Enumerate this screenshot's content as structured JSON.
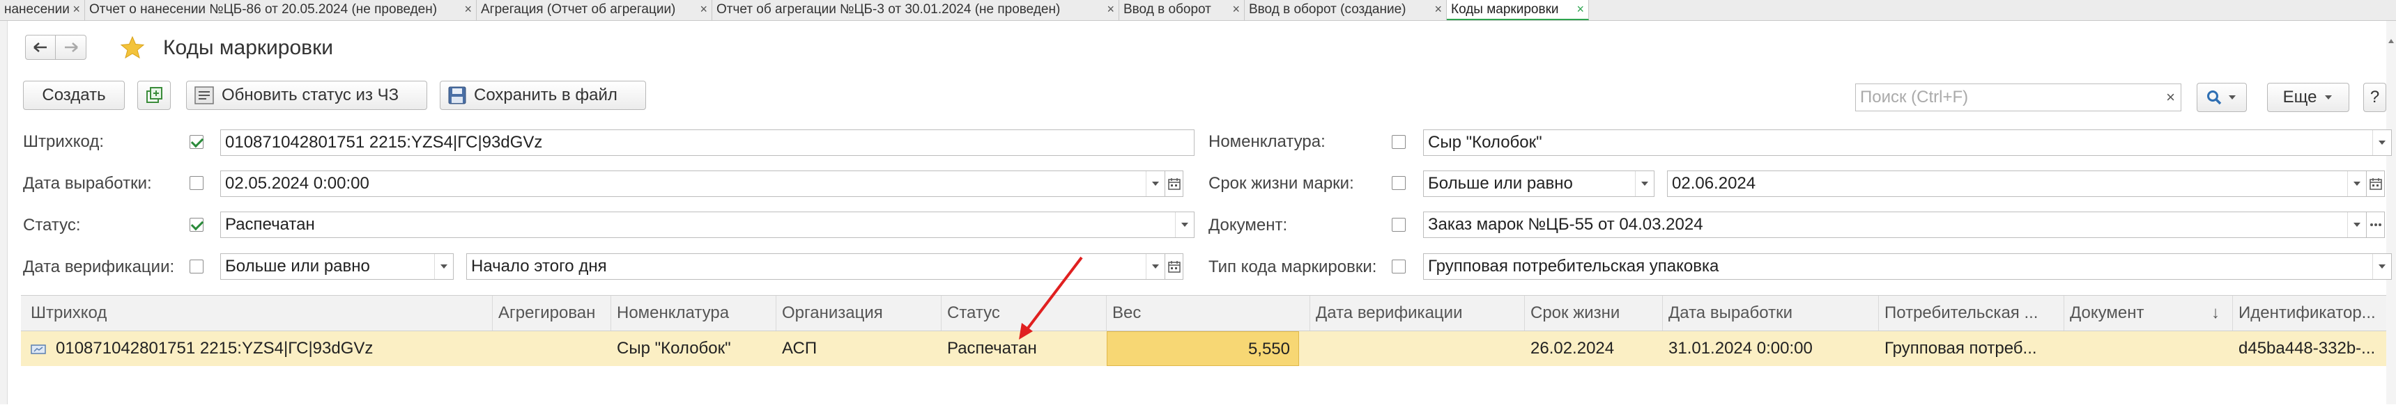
{
  "tabs": [
    {
      "label": "нанесении"
    },
    {
      "label": "Отчет о нанесении №ЦБ-86 от 20.05.2024 (не проведен)"
    },
    {
      "label": "Агрегация (Отчет об агрегации)"
    },
    {
      "label": "Отчет об агрегации №ЦБ-3 от 30.01.2024 (не проведен)"
    },
    {
      "label": "Ввод в оборот"
    },
    {
      "label": "Ввод в оборот (создание)"
    },
    {
      "label": "Коды маркировки"
    }
  ],
  "tab_close": "×",
  "header": {
    "title": "Коды маркировки"
  },
  "toolbar": {
    "create": "Создать",
    "refresh_status": "Обновить статус из ЧЗ",
    "save_file": "Сохранить в файл",
    "search_placeholder": "Поиск (Ctrl+F)",
    "search_clear": "×",
    "more": "Еще",
    "help": "?"
  },
  "filters": {
    "barcode": {
      "label": "Штрихкод:",
      "checked": true,
      "value": "010871042801751 2215:YZS4|ГС|93dGVz"
    },
    "prod_date": {
      "label": "Дата выработки:",
      "checked": false,
      "value": "02.05.2024  0:00:00"
    },
    "status": {
      "label": "Статус:",
      "checked": true,
      "value": "Распечатан"
    },
    "verify_date": {
      "label": "Дата верификации:",
      "checked": false,
      "op": "Больше или равно",
      "value": "Начало этого дня"
    },
    "nomenclature": {
      "label": "Номенклатура:",
      "checked": false,
      "value": "Сыр \"Колобок\""
    },
    "shelf_life": {
      "label": "Срок жизни марки:",
      "checked": false,
      "op": "Больше или равно",
      "value": "02.06.2024"
    },
    "document": {
      "label": "Документ:",
      "checked": false,
      "value": "Заказ марок №ЦБ-55 от 04.03.2024"
    },
    "code_type": {
      "label": "Тип кода маркировки:",
      "checked": false,
      "value": "Групповая потребительская упаковка"
    }
  },
  "table": {
    "columns": [
      "Штрихкод",
      "Агрегирован",
      "Номенклатура",
      "Организация",
      "Статус",
      "Вес",
      "Дата верификации",
      "Срок жизни",
      "Дата выработки",
      "Потребительская ...",
      "Документ",
      "Идентификатор..."
    ],
    "sort_arrow": "↓",
    "rows": [
      {
        "barcode": "010871042801751 2215:YZS4|ГС|93dGVz",
        "aggregated": "",
        "nomenclature": "Сыр \"Колобок\"",
        "organization": "АСП",
        "status": "Распечатан",
        "weight": "5,550",
        "verify_date": "",
        "shelf_life": "26.02.2024",
        "prod_date": "31.01.2024 0:00:00",
        "consumer": "Групповая потреб...",
        "document": "",
        "identifier": "d45ba448-332b-..."
      }
    ]
  },
  "colors": {
    "accent_green": "#2ea44f",
    "row_highlight": "#fbefc4",
    "cell_selected": "#f7d774",
    "arrow_red": "#e02020",
    "star": "#f3c33b"
  }
}
